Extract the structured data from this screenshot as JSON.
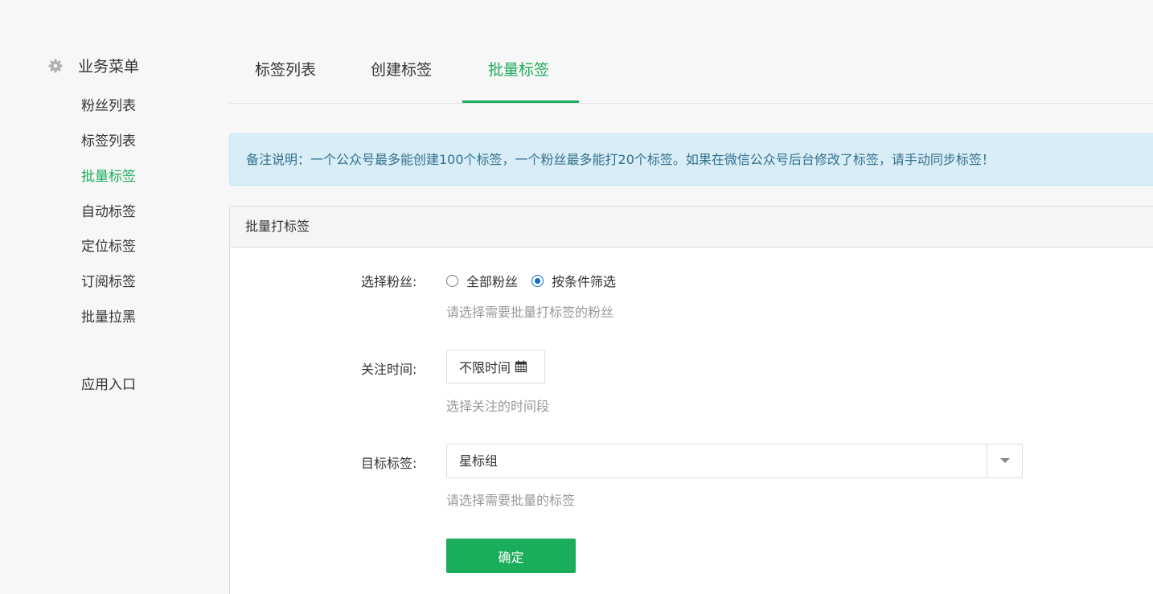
{
  "sidebar": {
    "title": "业务菜单",
    "icon": "gear-icon",
    "items": [
      {
        "label": "粉丝列表",
        "active": false
      },
      {
        "label": "标签列表",
        "active": false
      },
      {
        "label": "批量标签",
        "active": true
      },
      {
        "label": "自动标签",
        "active": false
      },
      {
        "label": "定位标签",
        "active": false
      },
      {
        "label": "订阅标签",
        "active": false
      },
      {
        "label": "批量拉黑",
        "active": false
      }
    ],
    "extra_item": {
      "label": "应用入口"
    }
  },
  "tabs": [
    {
      "label": "标签列表",
      "active": false
    },
    {
      "label": "创建标签",
      "active": false
    },
    {
      "label": "批量标签",
      "active": true
    }
  ],
  "notice": {
    "text": "备注说明：一个公众号最多能创建100个标签，一个粉丝最多能打20个标签。如果在微信公众号后台修改了标签，请手动同步标签！"
  },
  "panel": {
    "heading": "批量打标签",
    "fans": {
      "label": "选择粉丝:",
      "options": [
        {
          "label": "全部粉丝",
          "checked": false
        },
        {
          "label": "按条件筛选",
          "checked": true
        }
      ],
      "help": "请选择需要批量打标签的粉丝"
    },
    "follow_time": {
      "label": "关注时间:",
      "value": "不限时间",
      "icon": "calendar-icon",
      "help": "选择关注的时间段"
    },
    "target_tag": {
      "label": "目标标签:",
      "value": "星标组",
      "icon": "caret-down-icon",
      "help": "请选择需要批量的标签"
    },
    "submit_label": "确定"
  },
  "colors": {
    "accent": "#1aad5b",
    "notice_bg": "#d9edf7",
    "notice_text": "#31708f",
    "radio_checked": "#0a6ed1"
  }
}
